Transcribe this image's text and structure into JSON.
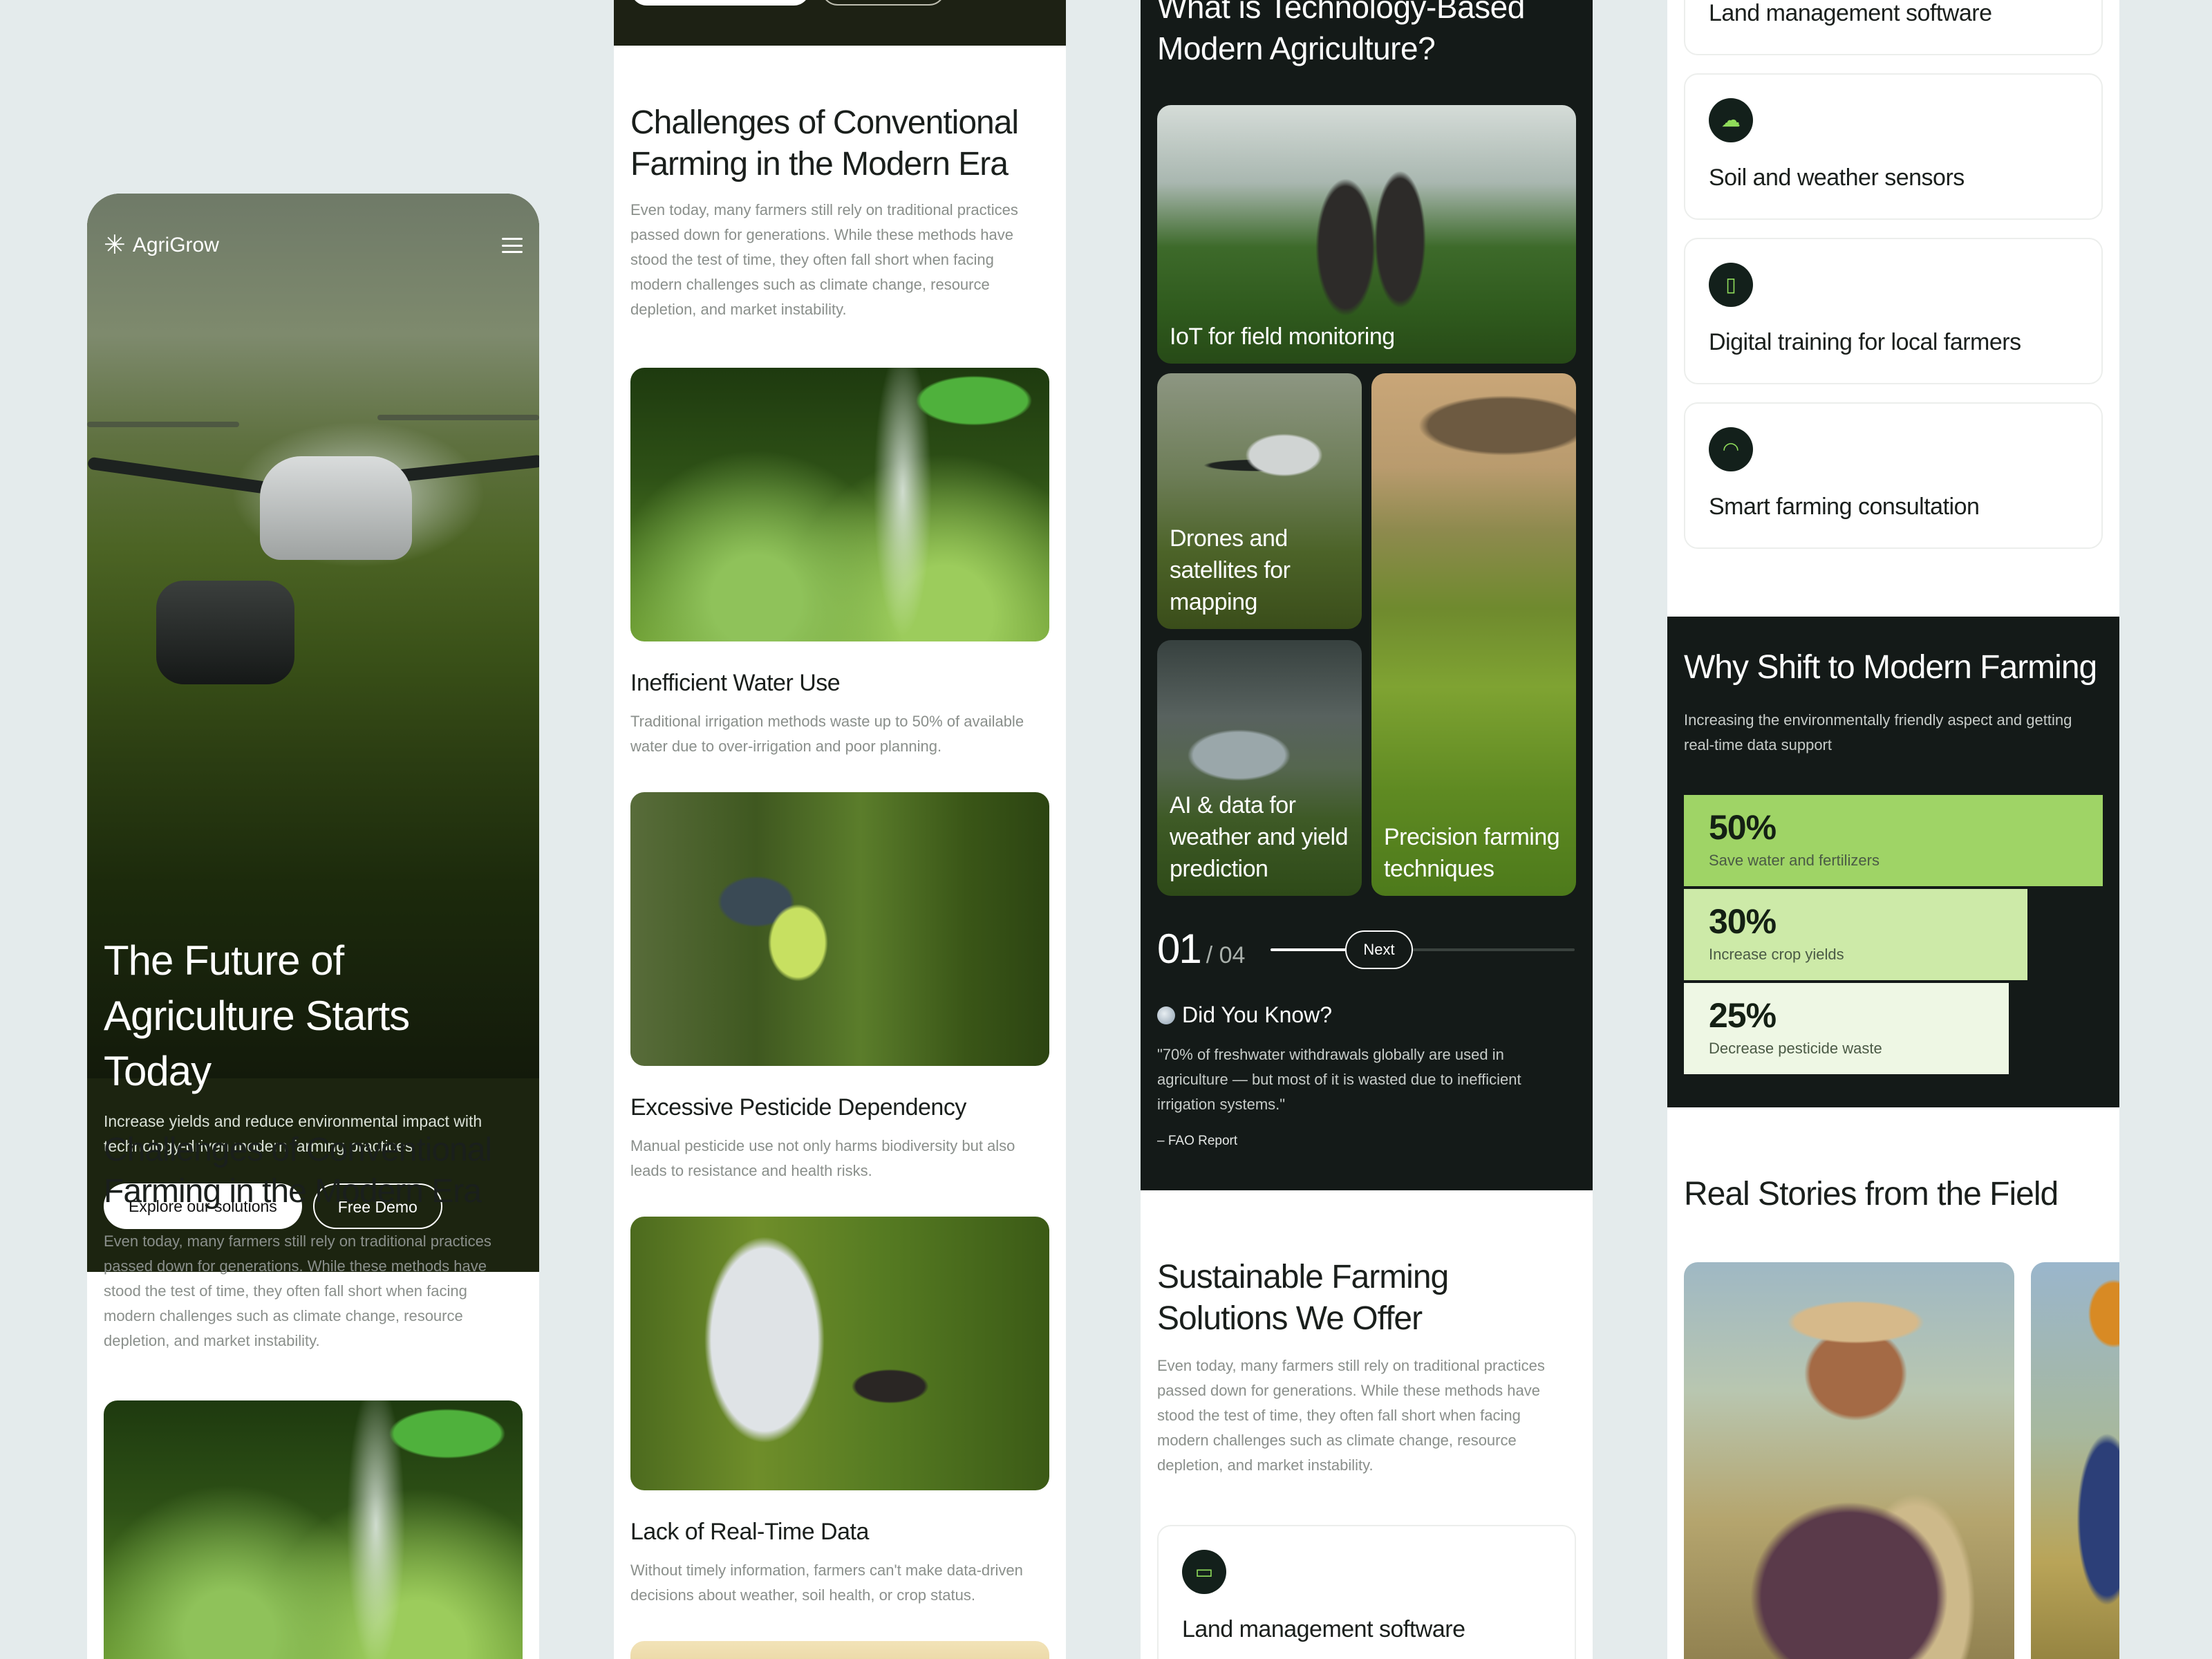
{
  "brand": {
    "name": "AgriGrow",
    "logo_icon": "✳"
  },
  "hero": {
    "title": "The Future of Agriculture Starts Today",
    "subtitle": "Increase yields and reduce environmental impact with technology-driven modern farming practices",
    "primary_button": "Explore our solutions",
    "secondary_button": "Free Demo"
  },
  "challenges": {
    "title": "Challenges of Conventional Farming in the Modern Era",
    "body": "Even today, many farmers still rely on traditional practices passed down for generations. While these methods have stood the test of time, they often fall short when facing modern challenges such as climate change, resource depletion, and market instability.",
    "items": [
      {
        "title": "Inefficient Water Use",
        "desc": "Traditional irrigation methods waste up to 50% of available water due to over-irrigation and poor planning."
      },
      {
        "title": "Excessive Pesticide Dependency",
        "desc": "Manual pesticide use not only harms biodiversity but also leads to resistance and health risks."
      },
      {
        "title": "Lack of Real-Time Data",
        "desc": "Without timely information, farmers can't make data-driven decisions about weather, soil health, or crop status."
      }
    ]
  },
  "tech": {
    "title": "What is Technology-Based Modern Agriculture?",
    "tiles": [
      {
        "label": "IoT for field monitoring"
      },
      {
        "label": "Drones and satellites for mapping"
      },
      {
        "label": "Precision farming techniques"
      },
      {
        "label": "AI & data for weather and yield prediction"
      }
    ],
    "counter_current": "01",
    "counter_total": "/ 04",
    "next_label": "Next",
    "slider_progress": 0.25
  },
  "did_you_know": {
    "title": "Did You Know?",
    "quote": "\"70% of freshwater withdrawals globally are used in agriculture — but most of it is wasted due to inefficient irrigation systems.\"",
    "source": "– FAO Report"
  },
  "solutions": {
    "title": "Sustainable Farming Solutions We Offer",
    "body": "Even today, many farmers still rely on traditional practices passed down for generations. While these methods have stood the test of time, they often fall short when facing modern challenges such as climate change, resource depletion, and market instability.",
    "items": [
      {
        "label": "Land management software",
        "icon": "laptop-icon"
      },
      {
        "label": "Soil and weather sensors",
        "icon": "cloud-icon"
      },
      {
        "label": "Digital training for local farmers",
        "icon": "tablet-icon"
      },
      {
        "label": "Smart farming consultation",
        "icon": "headset-icon"
      }
    ]
  },
  "why": {
    "title": "Why Shift to Modern Farming",
    "subtitle": "Increasing the environmentally friendly aspect and getting real-time data support",
    "stats": [
      {
        "value": "50%",
        "label": "Save water and fertilizers",
        "color": "#9fd466"
      },
      {
        "value": "30%",
        "label": "Increase crop yields",
        "color": "#cdeaa8"
      },
      {
        "value": "25%",
        "label": "Decrease pesticide waste",
        "color": "#eef7e4"
      }
    ]
  },
  "stories": {
    "title": "Real Stories from the Field"
  },
  "colors": {
    "accent": "#9fd466",
    "dark": "#141a18",
    "background": "#e4ebec"
  }
}
